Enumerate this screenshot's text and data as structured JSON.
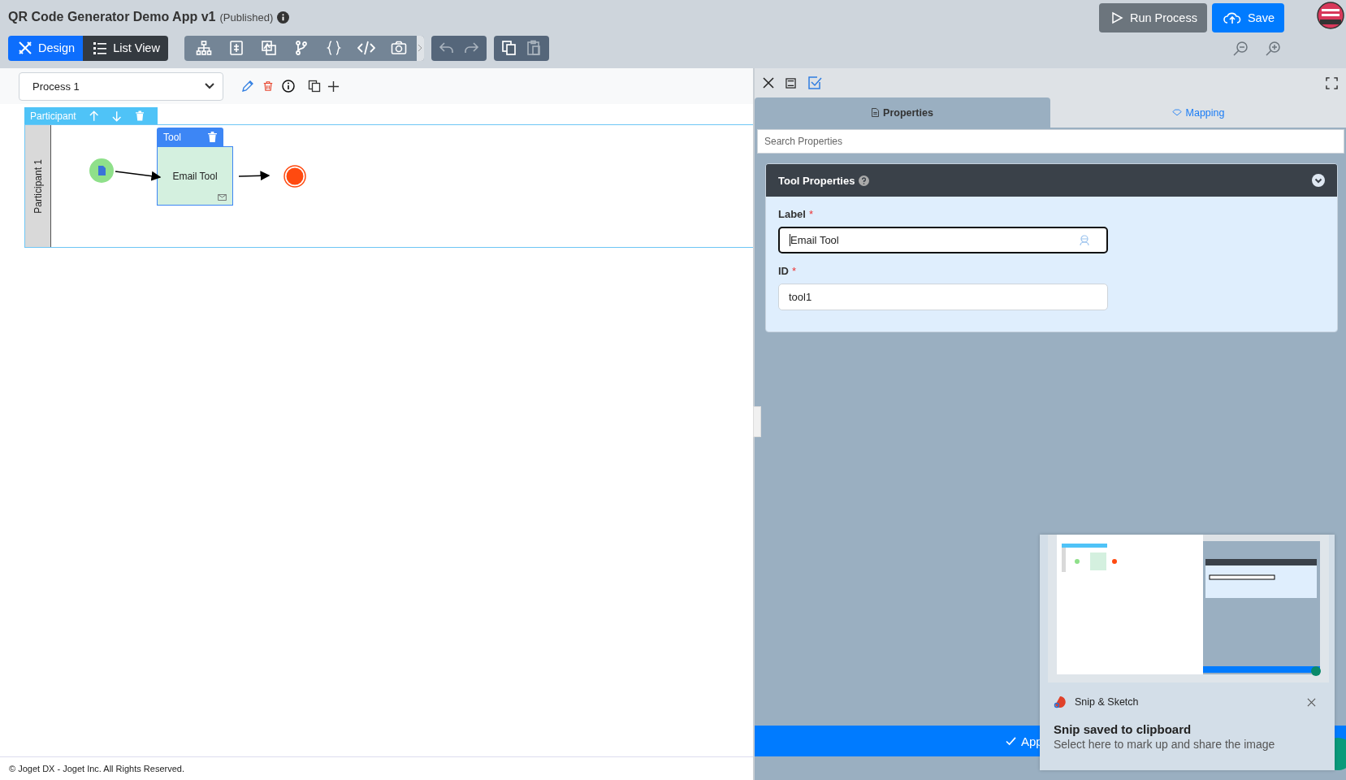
{
  "app": {
    "title": "QR Code Generator Demo App v1",
    "status": "(Published)"
  },
  "view_tabs": [
    {
      "label": "Design",
      "selected": true
    },
    {
      "label": "List View",
      "selected": false
    }
  ],
  "actions": [
    {
      "label": "Run Process",
      "kind": "secondary"
    },
    {
      "label": "Save",
      "kind": "primary"
    }
  ],
  "process_select": {
    "value": "Process 1"
  },
  "lane": {
    "header": "Participant",
    "name": "Participant 1"
  },
  "nodes": [
    {
      "kind": "start"
    },
    {
      "kind": "tool",
      "header": "Tool",
      "label": "Email Tool"
    },
    {
      "kind": "end"
    }
  ],
  "panel": {
    "tabs": [
      {
        "label": "Properties",
        "selected": true
      },
      {
        "label": "Mapping",
        "selected": false
      }
    ],
    "search": {
      "placeholder": "Search Properties"
    },
    "section": {
      "title": "Tool Properties",
      "expanded": true
    },
    "fields": [
      {
        "label": "Label",
        "required_mark": "*",
        "value": "Email Tool",
        "focused": true
      },
      {
        "label": "ID",
        "required_mark": "*",
        "value": "tool1",
        "focused": false
      }
    ],
    "apply_button": "App"
  },
  "toast": {
    "app": "Snip & Sketch",
    "title": "Snip saved to clipboard",
    "message": "Select here to mark up and share the image"
  },
  "footer": "© Joget DX - Joget Inc. All Rights Reserved."
}
